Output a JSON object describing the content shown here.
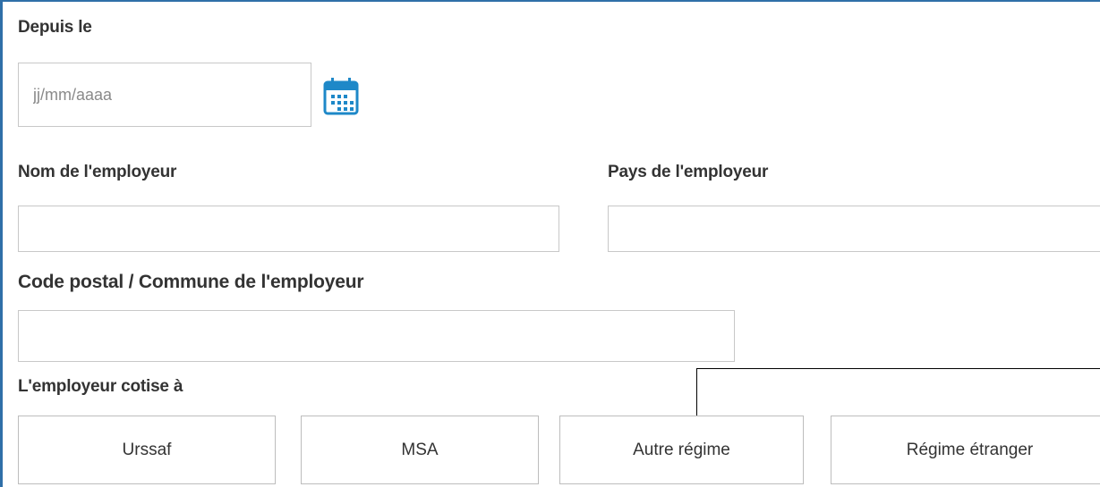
{
  "form": {
    "since": {
      "label": "Depuis le",
      "placeholder": "jj/mm/aaaa",
      "value": "",
      "icon": "calendar-icon"
    },
    "employer_name": {
      "label": "Nom de l'employeur",
      "value": ""
    },
    "employer_country": {
      "label": "Pays de l'employeur",
      "value": ""
    },
    "employer_postcode": {
      "label": "Code postal / Commune de l'employeur",
      "value": ""
    },
    "contribution": {
      "label": "L'employeur cotise à",
      "options": [
        "Urssaf",
        "MSA",
        "Autre régime",
        "Régime étranger"
      ]
    }
  },
  "colors": {
    "frame_border": "#2f6fa8",
    "calendar_icon": "#1e88c8",
    "label_text": "#333333",
    "input_border": "#c8c8c8"
  }
}
